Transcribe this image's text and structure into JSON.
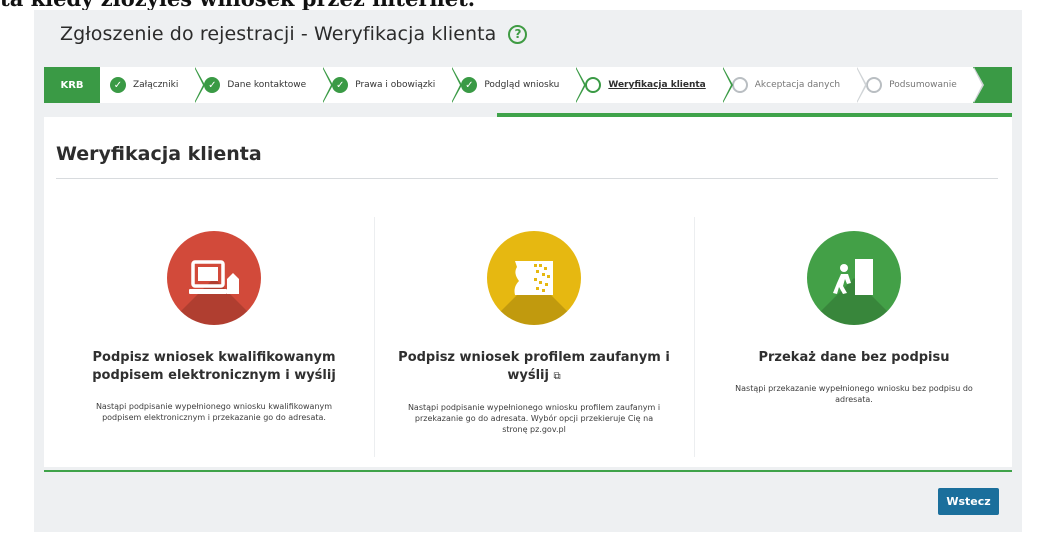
{
  "banner_text": "ta kiedy złożyłeś wniosek przez internet.",
  "page_title": "Zgłoszenie do rejestracji - Weryfikacja klienta",
  "help_icon": "help-circle-icon",
  "steps": {
    "krb": "KRB",
    "items": [
      {
        "label": "Załączniki",
        "state": "done"
      },
      {
        "label": "Dane kontaktowe",
        "state": "done"
      },
      {
        "label": "Prawa i obowiązki",
        "state": "done"
      },
      {
        "label": "Podgląd wniosku",
        "state": "done"
      },
      {
        "label": "Weryfikacja klienta",
        "state": "current"
      },
      {
        "label": "Akceptacja danych",
        "state": "pending"
      },
      {
        "label": "Podsumowanie",
        "state": "pending"
      }
    ]
  },
  "section_title": "Weryfikacja klienta",
  "options": [
    {
      "icon": "computer-signature-icon",
      "color": "#d24a3a",
      "title": "Podpisz wniosek kwalifikowanym podpisem elektronicznym i wyślij",
      "description": "Nastąpi podpisanie wypełnionego wniosku kwalifikowanym podpisem elektronicznym i przekazanie go do adresata."
    },
    {
      "icon": "trusted-profile-icon",
      "color": "#e6b811",
      "title": "Podpisz wniosek profilem zaufanym i wyślij",
      "external_icon": "external-link-icon",
      "description": "Nastąpi podpisanie wypełnionego wniosku profilem zaufanym i przekazanie go do adresata. Wybór opcji przekieruje Cię na stronę pz.gov.pl"
    },
    {
      "icon": "person-door-icon",
      "color": "#43a047",
      "title": "Przekaż dane bez podpisu",
      "description": "Nastąpi przekazanie wypełnionego wniosku bez podpisu do adresata."
    }
  ],
  "back_button": "Wstecz",
  "colors": {
    "accent": "#3a9a45",
    "button": "#1b6f9c"
  }
}
